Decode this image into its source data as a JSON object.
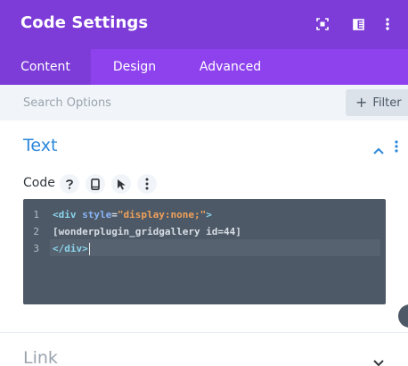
{
  "header": {
    "title": "Code Settings",
    "icons": [
      "screenshot-focus-icon",
      "sidebar-layout-icon",
      "more-vertical-icon"
    ]
  },
  "tabs": [
    {
      "label": "Content",
      "active": true
    },
    {
      "label": "Design",
      "active": false
    },
    {
      "label": "Advanced",
      "active": false
    }
  ],
  "search": {
    "placeholder": "Search Options",
    "value": "",
    "filter_label": "Filter"
  },
  "section": {
    "title": "Text",
    "field_label": "Code",
    "field_icons": [
      "help-icon",
      "mobile-icon",
      "cursor-icon",
      "more-vertical-icon"
    ],
    "accent_color": "#2b87da"
  },
  "editor": {
    "line_numbers": [
      "1",
      "2",
      "3"
    ],
    "lines": [
      {
        "tag_open": "<div",
        "attr": "style",
        "eq": "=",
        "str": "\"display:none;\"",
        "tag_close": ">"
      },
      {
        "text": "[wonderplugin_gridgallery id=44]"
      },
      {
        "tag": "</div>"
      }
    ]
  },
  "collapsed_section": {
    "title": "Link"
  },
  "colors": {
    "header_bg": "#7d3cd8",
    "tabs_bg": "#8e42ee",
    "editor_bg": "#4d5966"
  }
}
